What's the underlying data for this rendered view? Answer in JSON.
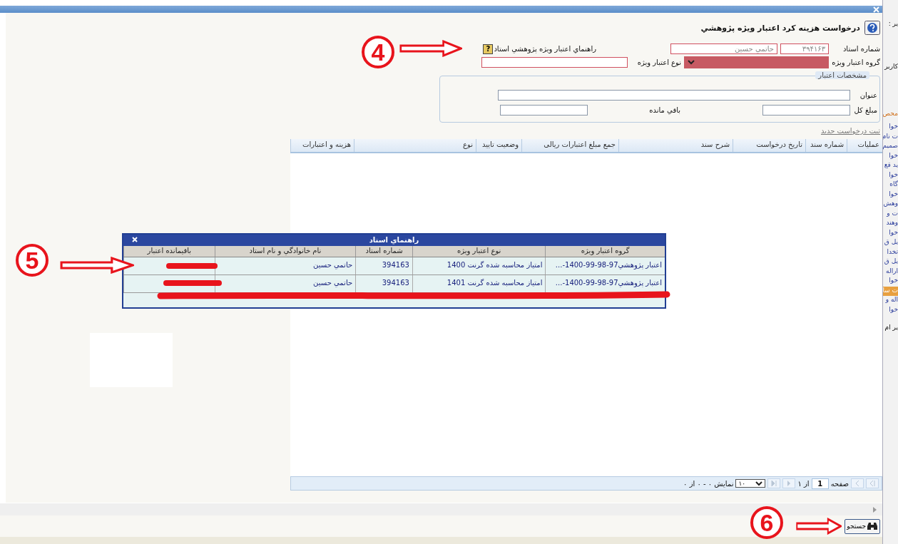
{
  "dialog": {
    "title": "درخواست هزينه كرد اعتبار ويژه پژوهشي"
  },
  "form": {
    "teacher_label": "شماره استاد",
    "teacher_number": "۳۹۴۱۶۳",
    "teacher_name": "حاتمي حسين",
    "guide_label": "راهنماي اعتبار ويژه پژوهشي استاد",
    "guide_button": "?",
    "group_label": "گروه اعتبار ويژه",
    "type_label": "نوع اعتبار ويژه"
  },
  "fieldset": {
    "legend": "مشخصات اعتبار",
    "title_label": "عنوان",
    "total_label": "مبلغ كل",
    "remaining_label": "باقي مانده"
  },
  "new_request_link": "ثبت درخواست جديد",
  "table": {
    "columns": [
      "عمليات",
      "شماره سند",
      "تاريخ درخواست",
      "شرح سند",
      "جمع مبلغ اعتبارات ريالی",
      "وضعيت تاييد",
      "نوع",
      "هزينه و اعتبارات"
    ]
  },
  "pager": {
    "page_label": "صفحه",
    "page": "1",
    "of": "از ۱",
    "page_size": "۱۰",
    "summary": "نمايش ۰ - ۰ از ۰"
  },
  "search_button": "جستجو",
  "popup": {
    "title": "راهنماي استاد",
    "columns": [
      "گروه اعتبار ويژه",
      "نوع اعتبار ويژه",
      "شماره استاد",
      "نام خانوادگي و نام استاد",
      "باقيمانده اعتبار"
    ],
    "rows": [
      {
        "cells": [
          "اعتبار پژوهشي97-98-99-1400-...",
          "امتياز محاسبه شده گرنت 1400",
          "394163",
          "حاتمي حسين"
        ]
      },
      {
        "cells": [
          "اعتبار پژوهشي97-98-99-1400-...",
          "امتياز محاسبه شده گرنت 1401",
          "394163",
          "حاتمي حسين"
        ]
      }
    ]
  },
  "annotations": [
    {
      "label": "4"
    },
    {
      "label": "5"
    },
    {
      "label": "6"
    }
  ],
  "side_strip": {
    "top": [
      "ير :",
      "كاربر"
    ],
    "header": "محص",
    "links": [
      {
        "text": "خوا",
        "selected": false
      },
      {
        "text": "ت نام",
        "selected": false
      },
      {
        "text": "صميم",
        "selected": false
      },
      {
        "text": "خوا",
        "selected": false
      },
      {
        "text": "يد قع",
        "selected": false
      },
      {
        "text": "خوا",
        "selected": false
      },
      {
        "text": "گاه",
        "selected": false
      },
      {
        "text": "خوا",
        "selected": false
      },
      {
        "text": "وهش",
        "selected": false
      },
      {
        "text": "ت و",
        "selected": false
      },
      {
        "text": "وهند",
        "selected": false
      },
      {
        "text": "خوا",
        "selected": false
      },
      {
        "text": "يل ق",
        "selected": false
      },
      {
        "text": "تخدا",
        "selected": false
      },
      {
        "text": "يل ق",
        "selected": false
      },
      {
        "text": "اراله",
        "selected": false
      },
      {
        "text": "خوا",
        "selected": false
      },
      {
        "text": "ت سا",
        "selected": true
      },
      {
        "text": "اله و",
        "selected": false
      },
      {
        "text": "خوا",
        "selected": false
      }
    ],
    "bottom": "ير ام"
  }
}
